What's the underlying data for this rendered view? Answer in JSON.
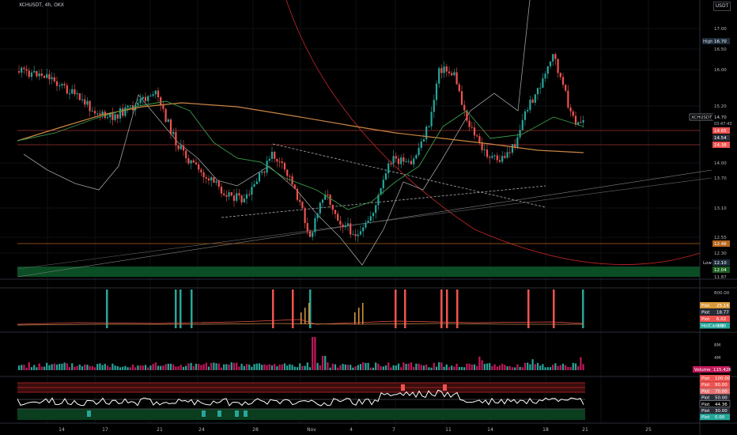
{
  "header": {
    "symbol": "XCHUSDT, 4h, OKX",
    "currency": "USDT"
  },
  "colors": {
    "up": "#26a69a",
    "down": "#ef5350",
    "bg": "#000000",
    "grid": "#1c1f26"
  },
  "main": {
    "price_ticks": [
      "17.00",
      "16.50",
      "16.00",
      "15.20",
      "14.00",
      "13.70",
      "13.10",
      "12.55",
      "12.30",
      "11.87"
    ],
    "high_label": "High",
    "high_value": "16.70",
    "low_label": "Low",
    "low_value": "12.10",
    "symbol_tag": "XCHUSDT",
    "last_price": "14.70",
    "countdown": "03:47:43",
    "price_tag_1": "14.65",
    "price_tag_2": "14.54",
    "price_tag_3": "14.38",
    "price_tag_4": "12.46",
    "price_tag_5": "12.04"
  },
  "pane1": {
    "tick_top": "800.00",
    "labels": [
      {
        "name": "Plot",
        "value": "25.14"
      },
      {
        "name": "Plot",
        "value": "18.77"
      },
      {
        "name": "Plot",
        "value": "6.02"
      },
      {
        "name": "HotCandle",
        "value": "0.00"
      }
    ]
  },
  "pane2": {
    "ticks": [
      "8M",
      "4M"
    ],
    "volume_label": "Volume",
    "volume_value": "115.42K"
  },
  "pane3": {
    "labels": [
      {
        "name": "Plot",
        "value": "100.00"
      },
      {
        "name": "Plot",
        "value": "90.00"
      },
      {
        "name": "Plot",
        "value": "70.00"
      },
      {
        "name": "Plot",
        "value": "50.00"
      },
      {
        "name": "Plot",
        "value": "44.36"
      },
      {
        "name": "Plot",
        "value": "30.00"
      },
      {
        "name": "Plot",
        "value": "0.00"
      }
    ]
  },
  "time_axis": [
    "14",
    "17",
    "21",
    "24",
    "28",
    "Nov",
    "4",
    "7",
    "11",
    "14",
    "18",
    "21",
    "25"
  ]
}
